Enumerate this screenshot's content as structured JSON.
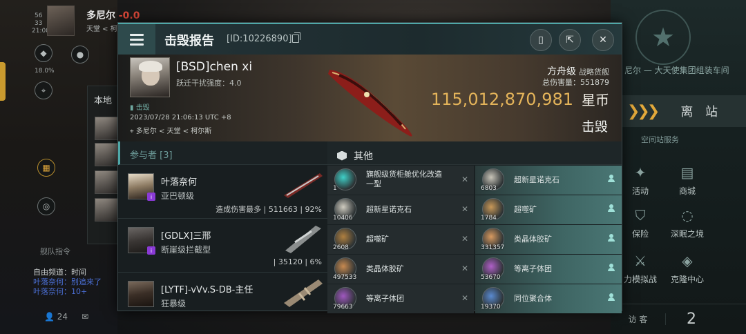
{
  "hud": {
    "player_name": "多尼尔",
    "security": "-0.0",
    "location": "天堂 < 柯",
    "time": "21:08",
    "small_stat_1": "56",
    "small_stat_2": "33",
    "percent": "18.0%",
    "local_label": "本地",
    "fleet_label": "舰队指令",
    "chat_lines": [
      "自由频道：时间",
      "叶落奈何：别追来了",
      "叶落奈何：10+"
    ],
    "members_count": "24",
    "station_name": "尼尔 — 大天使集团组装车间",
    "undock_label": "离 站",
    "services_label": "空间站服务",
    "services": [
      "活动",
      "商城",
      "保险",
      "深眠之境",
      "力模拟战",
      "克隆中心"
    ],
    "visitor_label": "访 客",
    "visitor_count": "2"
  },
  "report": {
    "title": "击毁报告",
    "id": "[ID:10226890]",
    "victim": {
      "name": "[BSD]chen xi",
      "warp": "跃迁干扰强度：4.0",
      "tag": "击毁",
      "time": "2023/07/28 21:06:13 UTC +8",
      "location": "多尼尔 < 天堂 < 柯尔斯",
      "ship_class": "方舟级",
      "ship_type": "战略货舰",
      "total_damage": "总伤害量：551879",
      "value": "115,012,870,981",
      "currency": "星币",
      "status": "击毁"
    },
    "participants_label": "参与者 [3]",
    "participants": [
      {
        "name": "叶落奈何",
        "ship": "亚巴顿级",
        "stat": "造成伤害最多 | 511663 | 92%"
      },
      {
        "name": "[GDLX]三邢",
        "ship": "断崖级拦截型",
        "stat": "| 35120 | 6%"
      },
      {
        "name": "[LYTF]-vVv.S-DB-主任",
        "ship": "狂暴级",
        "stat": ""
      }
    ],
    "others_label": "其他",
    "items": [
      {
        "qty": "1",
        "name": "旗舰级货柜舱优化改造 一型",
        "dropped": false
      },
      {
        "qty": "6803",
        "name": "超新星诺克石",
        "dropped": true
      },
      {
        "qty": "10406",
        "name": "超新星诺克石",
        "dropped": false
      },
      {
        "qty": "1784",
        "name": "超噬矿",
        "dropped": true
      },
      {
        "qty": "2608",
        "name": "超噬矿",
        "dropped": false
      },
      {
        "qty": "331357",
        "name": "类晶体胶矿",
        "dropped": true
      },
      {
        "qty": "497533",
        "name": "类晶体胶矿",
        "dropped": false
      },
      {
        "qty": "53670",
        "name": "等离子体团",
        "dropped": true
      },
      {
        "qty": "79663",
        "name": "等离子体团",
        "dropped": false
      },
      {
        "qty": "19370",
        "name": "同位聚合体",
        "dropped": true
      }
    ]
  }
}
